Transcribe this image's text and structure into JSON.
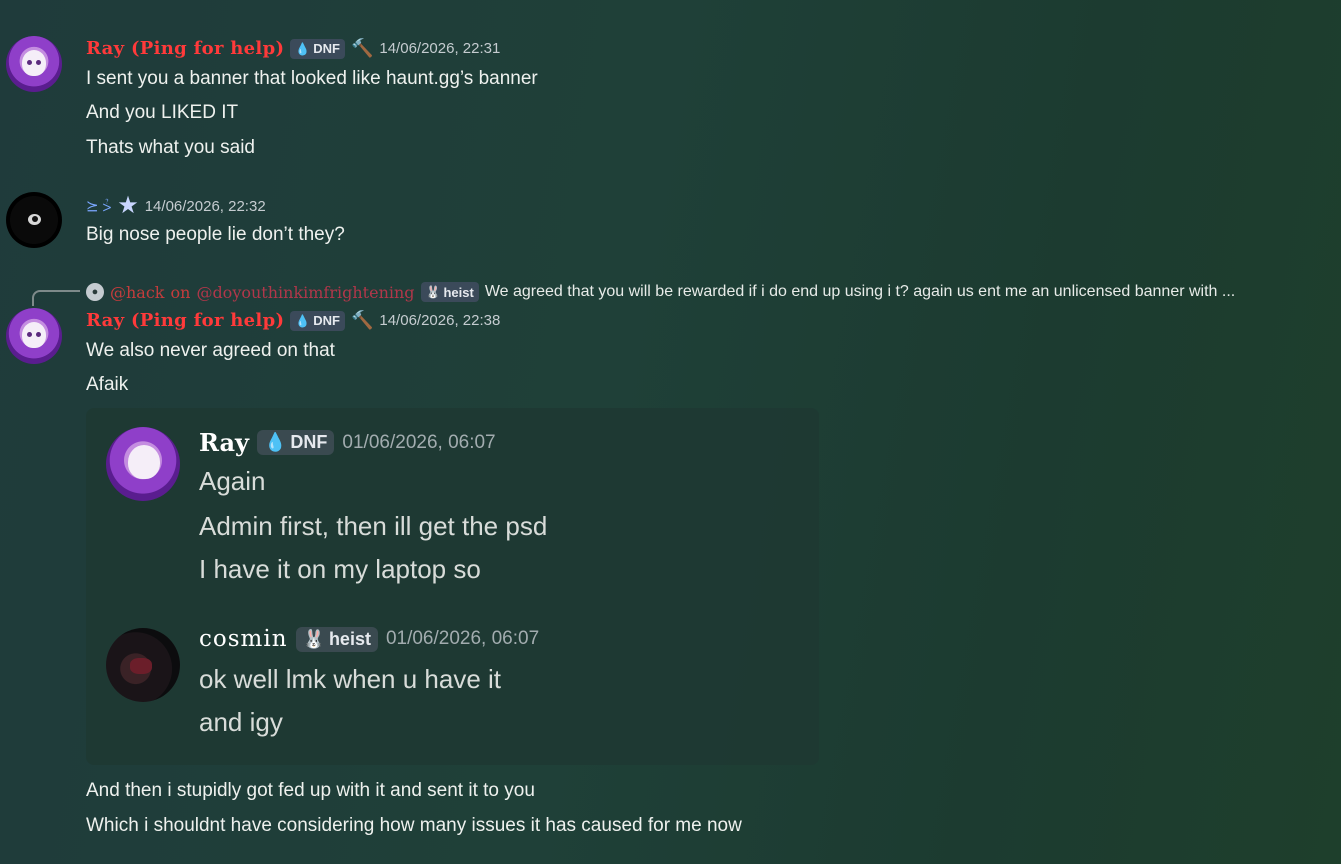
{
  "messages": {
    "m1": {
      "author": "Ray (Ping for help)",
      "tag": "DNF",
      "time": "14/06/2026, 22:31",
      "lines": [
        "I sent you a banner that looked like haunt.gg’s banner",
        "And you LIKED IT",
        "Thats what you said"
      ]
    },
    "m2": {
      "author": "⪰ ⩼",
      "time": "14/06/2026, 22:32",
      "lines": [
        "Big nose people lie don’t they?"
      ]
    },
    "reply": {
      "mention_a": "@hack",
      "word_on": "on",
      "mention_b": "@doyouthinkimfrightening",
      "tag": "heist",
      "text": "We agreed that you will be rewarded if i do end up using i t? again us ent me an unlicensed banner with ..."
    },
    "m3": {
      "author": "Ray (Ping for help)",
      "tag": "DNF",
      "time": "14/06/2026, 22:38",
      "lines": [
        "We also never agreed on that",
        "Afaik"
      ],
      "after_lines": [
        "And then i stupidly got fed up with it and sent it to you",
        "Which i shouldnt have considering how many issues it has caused for me now"
      ]
    }
  },
  "embed": {
    "q1": {
      "author": "Ray",
      "tag": "DNF",
      "time": "01/06/2026, 06:07",
      "lines": [
        "Again",
        "Admin first, then ill get the psd",
        "I have it on my laptop so"
      ]
    },
    "q2": {
      "author": "cosmin",
      "tag": "heist",
      "time": "01/06/2026, 06:07",
      "lines": [
        "ok well lmk when u have it",
        "and igy"
      ]
    }
  }
}
